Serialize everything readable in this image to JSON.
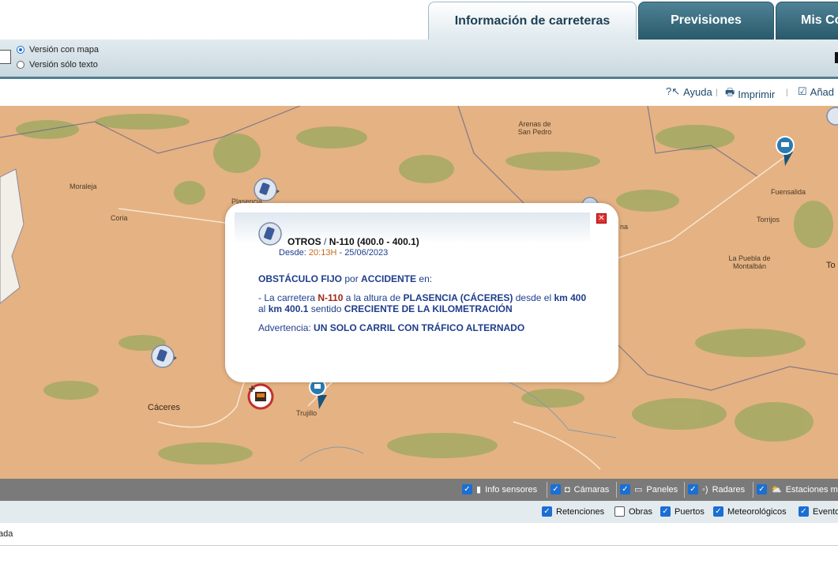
{
  "tabs": [
    {
      "label": "Información de carreteras",
      "active": true
    },
    {
      "label": "Previsiones",
      "active": false
    },
    {
      "label": "Mis Co",
      "active": false
    }
  ],
  "view_options": [
    {
      "label": "Versión con mapa",
      "selected": true
    },
    {
      "label": "Versión sólo texto",
      "selected": false
    }
  ],
  "tools": {
    "help": "Ayuda",
    "print": "Imprimir",
    "add": "Añad"
  },
  "map": {
    "places": [
      "Arenas de San Pedro",
      "Moraleja",
      "Plasencia",
      "Coria",
      "Fuensalida",
      "Torrijos",
      "La Puebla de Montalbán",
      "To",
      "Cáceres",
      "Trujillo",
      "na"
    ]
  },
  "popup": {
    "title_type": "OTROS",
    "title_road": "N-110 (400.0 - 400.1)",
    "since_label": "Desde:",
    "since_time": "20:13H",
    "since_date": "- 25/06/2023",
    "event_main": "OBSTÁCULO FIJO",
    "event_by": "por",
    "event_cause": "ACCIDENTE",
    "event_in": "en:",
    "d1": "- La carretera",
    "road": "N-110",
    "d2": "a la altura de",
    "location": "PLASENCIA (CÁCERES)",
    "d3": "desde el",
    "km_from": "km 400",
    "d4": "al",
    "km_to": "km 400.1",
    "d5": "sentido",
    "direction": "CRECIENTE DE LA KILOMETRACIÓN",
    "warning_label": "Advertencia:",
    "warning_text": "UN SOLO CARRIL CON TRÁFICO ALTERNADO"
  },
  "filters_row1": [
    {
      "label": "Info sensores",
      "checked": true,
      "icon": "sensor-icon"
    },
    {
      "label": "Cámaras",
      "checked": true,
      "icon": "camera-icon"
    },
    {
      "label": "Paneles",
      "checked": true,
      "icon": "panel-icon"
    },
    {
      "label": "Radares",
      "checked": true,
      "icon": "radar-icon"
    },
    {
      "label": "Estaciones m",
      "checked": true,
      "icon": "weather-station-icon"
    }
  ],
  "filters_row2": [
    {
      "label": "Retenciones",
      "checked": true
    },
    {
      "label": "Obras",
      "checked": false
    },
    {
      "label": "Puertos",
      "checked": true
    },
    {
      "label": "Meteorológicos",
      "checked": true
    },
    {
      "label": "Evento",
      "checked": true
    }
  ],
  "footer_text": "ada",
  "colors": {
    "tab_dark": "#2a5b6d",
    "map_bg": "#e5b283",
    "popup_text": "#1e3d8c",
    "checkbox": "#1b6fd2"
  }
}
